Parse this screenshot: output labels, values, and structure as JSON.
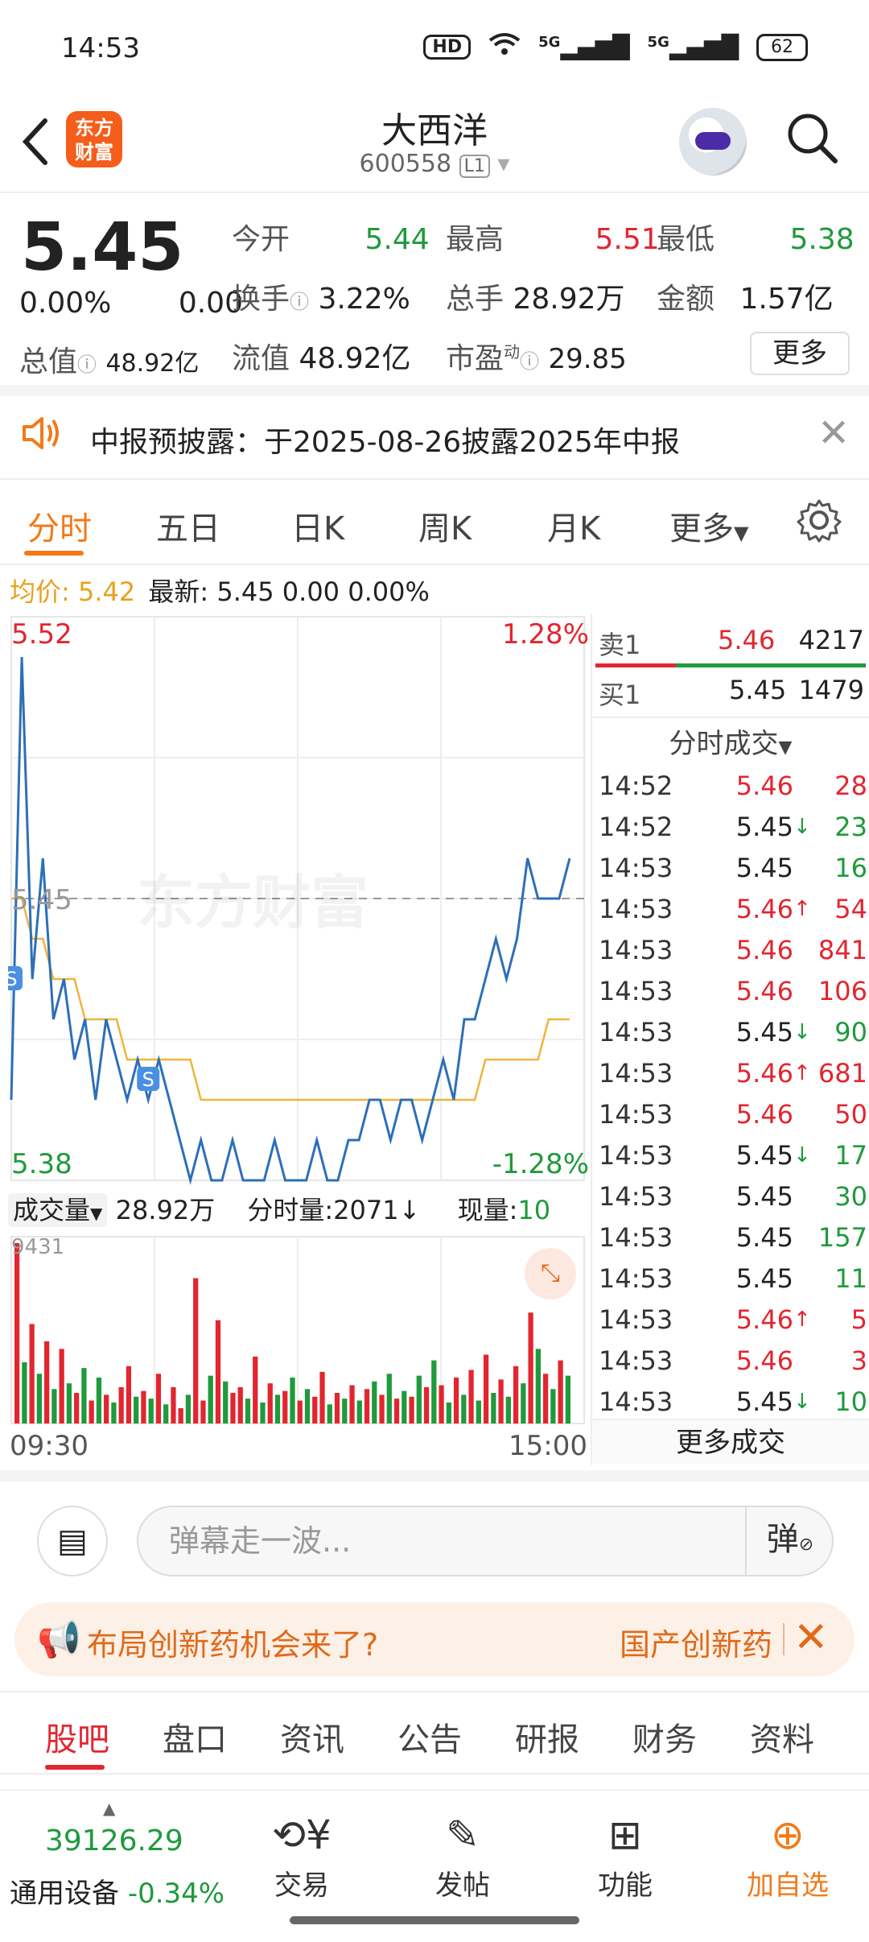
{
  "status_bar": {
    "time": "14:53",
    "signal1": "5G",
    "signal2": "5G",
    "battery": "62",
    "hd": "HD"
  },
  "header": {
    "back_icon": "chevron-left-icon",
    "logo_text": "东方财富",
    "title": "大西洋",
    "code": "600558",
    "level": "L1",
    "search_icon": "search-icon"
  },
  "quote": {
    "price": "5.45",
    "change_pct": "0.00%",
    "change": "0.00",
    "open_label": "今开",
    "open": "5.44",
    "high_label": "最高",
    "high": "5.51",
    "low_label": "最低",
    "low": "5.38",
    "turnover_label": "换手",
    "turnover": "3.22%",
    "volume_label": "总手",
    "volume": "28.92万",
    "amount_label": "金额",
    "amount": "1.57亿",
    "mktcap_label": "总值",
    "mktcap": "48.92亿",
    "float_label": "流值",
    "float": "48.92亿",
    "pe_label": "市盈",
    "pe_sup": "动",
    "pe": "29.85",
    "more_label": "更多"
  },
  "notice": {
    "text": "中报预披露：于2025-08-26披露2025年中报"
  },
  "chart_tabs": [
    "分时",
    "五日",
    "日K",
    "周K",
    "月K",
    "更多"
  ],
  "avg_line": {
    "avg_label": "均价:",
    "avg": "5.42",
    "latest_label": "最新:",
    "latest": "5.45",
    "change": "0.00",
    "pct": "0.00%"
  },
  "chart_labels": {
    "top_price": "5.52",
    "top_pct": "1.28%",
    "bottom_price": "5.38",
    "bottom_pct": "-1.28%",
    "mid_price": "5.45",
    "watermark": "东方财富",
    "marker": "S"
  },
  "vol_header": {
    "selector": "成交量",
    "volume": "28.92万",
    "tick_label": "分时量:2071",
    "tick_arrow": "↓",
    "now_label": "现量:",
    "now": "10",
    "max": "9431"
  },
  "time_axis": {
    "start": "09:30",
    "end": "15:00"
  },
  "depth": {
    "sell_label": "卖1",
    "sell_price": "5.46",
    "sell_vol": "4217",
    "buy_label": "买1",
    "buy_price": "5.45",
    "buy_vol": "1479",
    "ticks_title": "分时成交",
    "ticks": [
      {
        "t": "14:52",
        "p": "5.46",
        "a": "",
        "v": "28",
        "pc": "red",
        "vc": "red"
      },
      {
        "t": "14:52",
        "p": "5.45",
        "a": "↓",
        "v": "23",
        "pc": "black",
        "vc": "green"
      },
      {
        "t": "14:53",
        "p": "5.45",
        "a": "",
        "v": "16",
        "pc": "black",
        "vc": "green"
      },
      {
        "t": "14:53",
        "p": "5.46",
        "a": "↑",
        "v": "54",
        "pc": "red",
        "vc": "red"
      },
      {
        "t": "14:53",
        "p": "5.46",
        "a": "",
        "v": "841",
        "pc": "red",
        "vc": "red"
      },
      {
        "t": "14:53",
        "p": "5.46",
        "a": "",
        "v": "106",
        "pc": "red",
        "vc": "red"
      },
      {
        "t": "14:53",
        "p": "5.45",
        "a": "↓",
        "v": "90",
        "pc": "black",
        "vc": "green"
      },
      {
        "t": "14:53",
        "p": "5.46",
        "a": "↑",
        "v": "681",
        "pc": "red",
        "vc": "red"
      },
      {
        "t": "14:53",
        "p": "5.46",
        "a": "",
        "v": "50",
        "pc": "red",
        "vc": "red"
      },
      {
        "t": "14:53",
        "p": "5.45",
        "a": "↓",
        "v": "17",
        "pc": "black",
        "vc": "green"
      },
      {
        "t": "14:53",
        "p": "5.45",
        "a": "",
        "v": "30",
        "pc": "black",
        "vc": "green"
      },
      {
        "t": "14:53",
        "p": "5.45",
        "a": "",
        "v": "157",
        "pc": "black",
        "vc": "green"
      },
      {
        "t": "14:53",
        "p": "5.45",
        "a": "",
        "v": "11",
        "pc": "black",
        "vc": "green"
      },
      {
        "t": "14:53",
        "p": "5.46",
        "a": "↑",
        "v": "5",
        "pc": "red",
        "vc": "red"
      },
      {
        "t": "14:53",
        "p": "5.46",
        "a": "",
        "v": "3",
        "pc": "red",
        "vc": "red"
      },
      {
        "t": "14:53",
        "p": "5.45",
        "a": "↓",
        "v": "10",
        "pc": "black",
        "vc": "green"
      }
    ],
    "more_deals": "更多成交"
  },
  "danmu": {
    "placeholder": "弹幕走一波...",
    "send_label": "弹"
  },
  "promo": {
    "text": "布局创新药机会来了?",
    "side_text": "国产创新药"
  },
  "bottom_tabs": [
    "股吧",
    "盘口",
    "资讯",
    "公告",
    "研报",
    "财务",
    "资料"
  ],
  "bottom_nav": {
    "index_value": "39126.29",
    "index_name": "通用设备",
    "index_change": "-0.34%",
    "items": [
      {
        "label": "交易",
        "icon": "trade-icon"
      },
      {
        "label": "发帖",
        "icon": "post-icon"
      },
      {
        "label": "功能",
        "icon": "apps-icon"
      },
      {
        "label": "加自选",
        "icon": "add-watchlist-icon"
      }
    ]
  },
  "colors": {
    "up": "#e2262f",
    "down": "#1f9a3c",
    "accent": "#f27a1a",
    "price_line": "#2d6fb8",
    "avg_line": "#f0b43c"
  },
  "chart_data": {
    "type": "line",
    "title": "",
    "xlabel": "",
    "ylabel": "",
    "x_range": [
      "09:30",
      "15:00"
    ],
    "ylim": [
      5.38,
      5.52
    ],
    "series": [
      {
        "values": [
          5.4,
          5.51,
          5.43,
          5.46,
          5.42,
          5.43,
          5.41,
          5.42,
          5.4,
          5.42,
          5.41,
          5.4,
          5.41,
          5.4,
          5.41,
          5.4,
          5.39,
          5.38,
          5.39,
          5.38,
          5.38,
          5.39,
          5.38,
          5.38,
          5.38,
          5.39,
          5.38,
          5.38,
          5.38,
          5.39,
          5.38,
          5.38,
          5.39,
          5.39,
          5.4,
          5.4,
          5.39,
          5.4,
          5.4,
          5.39,
          5.4,
          5.41,
          5.4,
          5.42,
          5.42,
          5.43,
          5.44,
          5.43,
          5.44,
          5.46,
          5.45,
          5.45,
          5.45,
          5.46
        ]
      },
      {
        "values": [
          5.45,
          5.45,
          5.44,
          5.44,
          5.43,
          5.43,
          5.43,
          5.42,
          5.42,
          5.42,
          5.42,
          5.41,
          5.41,
          5.41,
          5.41,
          5.41,
          5.41,
          5.41,
          5.4,
          5.4,
          5.4,
          5.4,
          5.4,
          5.4,
          5.4,
          5.4,
          5.4,
          5.4,
          5.4,
          5.4,
          5.4,
          5.4,
          5.4,
          5.4,
          5.4,
          5.4,
          5.4,
          5.4,
          5.4,
          5.4,
          5.4,
          5.4,
          5.4,
          5.4,
          5.4,
          5.41,
          5.41,
          5.41,
          5.41,
          5.41,
          5.41,
          5.42,
          5.42,
          5.42
        ]
      }
    ],
    "volume_ylim": [
      0,
      9431
    ],
    "volume": [
      {
        "v": 9431,
        "c": "red"
      },
      {
        "v": 3200,
        "c": "green"
      },
      {
        "v": 5200,
        "c": "red"
      },
      {
        "v": 2600,
        "c": "green"
      },
      {
        "v": 4300,
        "c": "red"
      },
      {
        "v": 1800,
        "c": "green"
      },
      {
        "v": 3900,
        "c": "red"
      },
      {
        "v": 2100,
        "c": "green"
      },
      {
        "v": 1600,
        "c": "red"
      },
      {
        "v": 2900,
        "c": "green"
      },
      {
        "v": 1200,
        "c": "red"
      },
      {
        "v": 2400,
        "c": "green"
      },
      {
        "v": 1500,
        "c": "red"
      },
      {
        "v": 1100,
        "c": "green"
      },
      {
        "v": 1900,
        "c": "red"
      },
      {
        "v": 3000,
        "c": "red"
      },
      {
        "v": 1400,
        "c": "green"
      },
      {
        "v": 1700,
        "c": "red"
      },
      {
        "v": 1300,
        "c": "green"
      },
      {
        "v": 2600,
        "c": "red"
      },
      {
        "v": 1000,
        "c": "green"
      },
      {
        "v": 1900,
        "c": "red"
      },
      {
        "v": 800,
        "c": "red"
      },
      {
        "v": 1500,
        "c": "green"
      },
      {
        "v": 7600,
        "c": "red"
      },
      {
        "v": 1200,
        "c": "red"
      },
      {
        "v": 2500,
        "c": "green"
      },
      {
        "v": 5400,
        "c": "red"
      },
      {
        "v": 2200,
        "c": "green"
      },
      {
        "v": 1600,
        "c": "red"
      },
      {
        "v": 1900,
        "c": "red"
      },
      {
        "v": 1300,
        "c": "green"
      },
      {
        "v": 3500,
        "c": "red"
      },
      {
        "v": 1100,
        "c": "green"
      },
      {
        "v": 2100,
        "c": "red"
      },
      {
        "v": 1500,
        "c": "green"
      },
      {
        "v": 1700,
        "c": "red"
      },
      {
        "v": 2400,
        "c": "green"
      },
      {
        "v": 1200,
        "c": "red"
      },
      {
        "v": 1800,
        "c": "green"
      },
      {
        "v": 1400,
        "c": "red"
      },
      {
        "v": 2700,
        "c": "red"
      },
      {
        "v": 1000,
        "c": "green"
      },
      {
        "v": 1600,
        "c": "red"
      },
      {
        "v": 1300,
        "c": "green"
      },
      {
        "v": 2000,
        "c": "red"
      },
      {
        "v": 1200,
        "c": "green"
      },
      {
        "v": 1800,
        "c": "red"
      },
      {
        "v": 2200,
        "c": "green"
      },
      {
        "v": 1500,
        "c": "red"
      },
      {
        "v": 2600,
        "c": "green"
      },
      {
        "v": 1300,
        "c": "red"
      },
      {
        "v": 1700,
        "c": "green"
      },
      {
        "v": 1400,
        "c": "red"
      },
      {
        "v": 2500,
        "c": "green"
      },
      {
        "v": 1900,
        "c": "red"
      },
      {
        "v": 3300,
        "c": "green"
      },
      {
        "v": 2000,
        "c": "red"
      },
      {
        "v": 1100,
        "c": "green"
      },
      {
        "v": 2400,
        "c": "red"
      },
      {
        "v": 1500,
        "c": "green"
      },
      {
        "v": 2800,
        "c": "red"
      },
      {
        "v": 1200,
        "c": "green"
      },
      {
        "v": 3600,
        "c": "red"
      },
      {
        "v": 1600,
        "c": "green"
      },
      {
        "v": 2300,
        "c": "red"
      },
      {
        "v": 1400,
        "c": "green"
      },
      {
        "v": 3000,
        "c": "red"
      },
      {
        "v": 2100,
        "c": "green"
      },
      {
        "v": 5800,
        "c": "red"
      },
      {
        "v": 3900,
        "c": "green"
      },
      {
        "v": 2600,
        "c": "red"
      },
      {
        "v": 1800,
        "c": "green"
      },
      {
        "v": 3300,
        "c": "red"
      },
      {
        "v": 2500,
        "c": "green"
      }
    ]
  }
}
